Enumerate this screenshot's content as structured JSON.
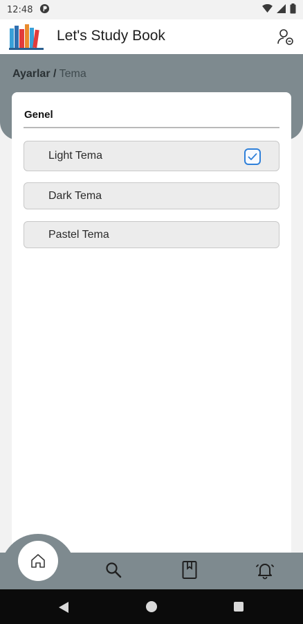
{
  "status_bar": {
    "time": "12:48"
  },
  "app_bar": {
    "title": "Let's Study Book"
  },
  "breadcrumb": {
    "root": "Ayarlar",
    "separator": "/",
    "current": "Tema"
  },
  "section": {
    "title": "Genel"
  },
  "themes": [
    {
      "label": "Light Tema",
      "selected": true
    },
    {
      "label": "Dark Tema",
      "selected": false
    },
    {
      "label": "Pastel Tema",
      "selected": false
    }
  ],
  "colors": {
    "accent": "#2f80d9",
    "header_gray": "#7e8a8f",
    "card": "#ffffff"
  },
  "bottom_nav": {
    "items": [
      "home-icon",
      "search-icon",
      "book-icon",
      "bell-icon"
    ],
    "active": "home-icon"
  }
}
